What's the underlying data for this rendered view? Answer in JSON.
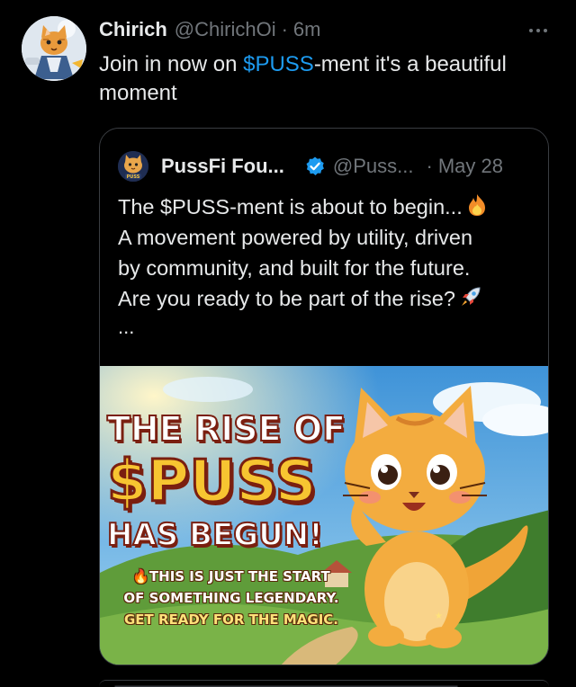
{
  "post": {
    "author_name": "Chirich",
    "author_handle": "@ChirichOi",
    "dot": "·",
    "time": "6m",
    "text_cashtag": "$PUSS",
    "text_rest": "-ment it's a beautiful moment",
    "text_prefix": "Join in now on ",
    "more_icon": "more-horizontal-icon"
  },
  "quote": {
    "author_name": "PussFi Fou...",
    "author_handle": "@Puss...",
    "dot": "·",
    "date": "May 28",
    "verified": true,
    "lines": [
      "The $PUSS-ment is about to begin...",
      "A movement powered by utility, driven",
      "by community, and built for the future.",
      "Are you ready to be part of the rise?"
    ],
    "ellipsis": "...",
    "line1_icon": "fire-icon",
    "line4_icon": "rocket-icon"
  },
  "media": {
    "headline_1": "THE RISE OF",
    "headline_2": "$PUSS",
    "headline_3": "HAS BEGUN!",
    "sub_1": "THIS IS JUST THE START",
    "sub_2": "OF SOMETHING LEGENDARY.",
    "sub_3": "GET READY FOR THE MAGIC.",
    "avatar_badge": "PUSS"
  },
  "colors": {
    "background": "#000000",
    "text": "#e7e9ea",
    "muted": "#71767b",
    "link": "#1d9bf0",
    "verified": "#1d9bf0"
  }
}
